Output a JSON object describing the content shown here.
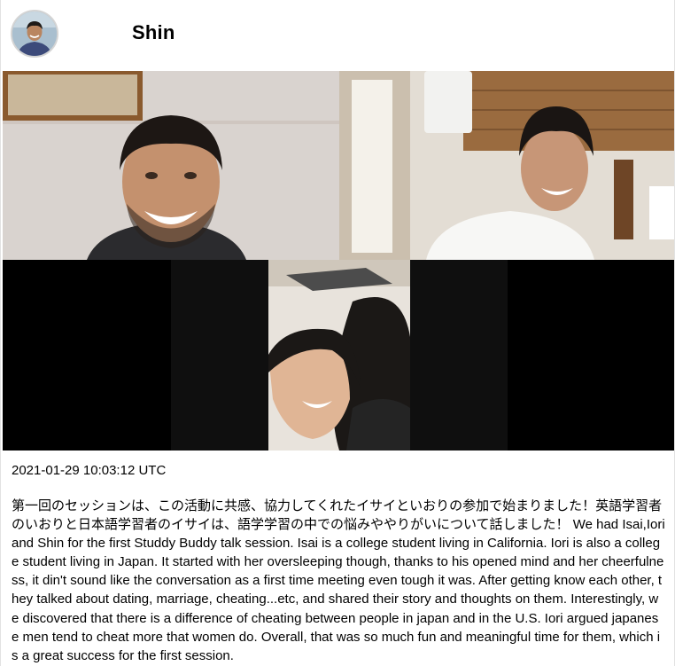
{
  "post": {
    "author": {
      "name": "Shin",
      "avatar_icon": "profile-photo"
    },
    "photo": {
      "description_icon": "video-call-screenshot",
      "participants": 3
    },
    "timestamp": "2021-01-29 10:03:12 UTC",
    "text": "第一回のセッションは、この活動に共感、協力してくれたイサイといおりの参加で始まりました！英語学習者のいおりと日本語学習者のイサイは、語学学習の中での悩みややりがいについて話しました！ We had Isai,Iori and Shin for the first Studdy Buddy talk session. Isai is a college student living in California. Iori is also a college student living in Japan. It started with her oversleeping though, thanks to his opened mind and her cheerfulness, it din't sound like the conversation as a first time meeting even tough it was. After getting know each other, they talked about dating, marriage, cheating...etc, and shared their story and thoughts on them. Interestingly, we discovered that there is a difference of cheating between people in japan and in the U.S. Iori argued japanese men tend to cheat more that women do. Overall, that was so much fun and meaningful time for them, which is a great success for the first session."
  },
  "colors": {
    "background": "#ffffff",
    "text": "#000000",
    "video_background": "#000000"
  }
}
